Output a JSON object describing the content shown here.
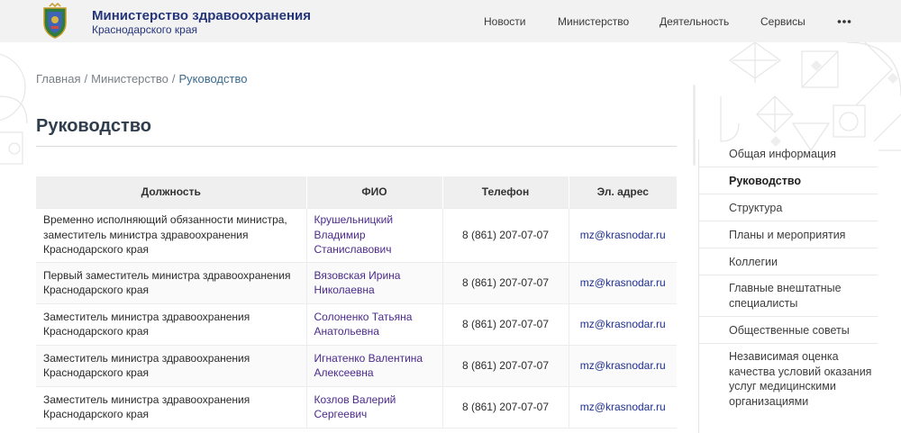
{
  "header": {
    "title": "Министерство здравоохранения",
    "subtitle": "Краснодарского края",
    "nav": [
      "Новости",
      "Министерство",
      "Деятельность",
      "Сервисы"
    ],
    "more_icon": "more-horizontal-icon"
  },
  "breadcrumb": {
    "items": [
      "Главная",
      "Министерство",
      "Руководство"
    ],
    "separator": "/"
  },
  "page_title": "Руководство",
  "table": {
    "headers": [
      "Должность",
      "ФИО",
      "Телефон",
      "Эл. адрес"
    ],
    "rows": [
      {
        "position": "Временно исполняющий обязанности министра, заместитель министра здравоохранения Краснодарского края",
        "name": "Крушельницкий Владимир Станиславович",
        "phone": "8 (861) 207-07-07",
        "email": "mz@krasnodar.ru"
      },
      {
        "position": "Первый заместитель министра здравоохранения Краснодарского края",
        "name": "Вязовская Ирина Николаевна",
        "phone": "8 (861) 207-07-07",
        "email": "mz@krasnodar.ru"
      },
      {
        "position": "Заместитель министра здравоохранения Краснодарского края",
        "name": "Солоненко Татьяна Анатольевна",
        "phone": "8 (861) 207-07-07",
        "email": "mz@krasnodar.ru"
      },
      {
        "position": "Заместитель министра здравоохранения Краснодарского края",
        "name": "Игнатенко Валентина Алексеевна",
        "phone": "8 (861) 207-07-07",
        "email": "mz@krasnodar.ru"
      },
      {
        "position": "Заместитель министра здравоохранения Краснодарского края",
        "name": "Козлов Валерий Сергеевич",
        "phone": "8 (861) 207-07-07",
        "email": "mz@krasnodar.ru"
      }
    ]
  },
  "sidebar": {
    "active_index": 1,
    "items": [
      "Общая информация",
      "Руководство",
      "Структура",
      "Планы и мероприятия",
      "Коллегии",
      "Главные внештатные специалисты",
      "Общественные советы",
      "Независимая оценка качества условий оказания услуг медицинскими организациями"
    ]
  },
  "colors": {
    "brand": "#24357a",
    "link_name": "#4b2a8c",
    "link_email": "#1e2f8f",
    "header_bg": "#f2f2f2"
  }
}
